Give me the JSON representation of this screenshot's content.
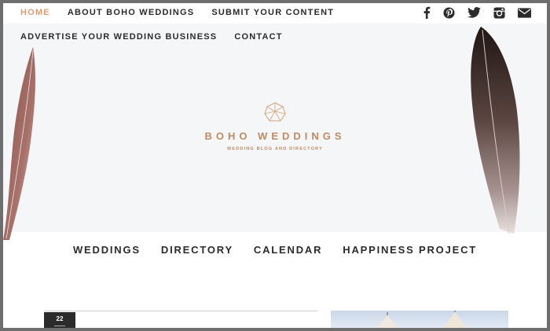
{
  "top_nav": {
    "items": [
      {
        "label": "HOME",
        "active": true
      },
      {
        "label": "ABOUT BOHO WEDDINGS"
      },
      {
        "label": "SUBMIT YOUR CONTENT"
      }
    ],
    "items_row2": [
      {
        "label": "ADVERTISE YOUR WEDDING BUSINESS"
      },
      {
        "label": "CONTACT"
      }
    ]
  },
  "social_icons": [
    "facebook-icon",
    "pinterest-icon",
    "twitter-icon",
    "instagram-icon",
    "email-icon"
  ],
  "brand": {
    "name": "BOHO WEDDINGS",
    "tagline": "WEDDING BLOG AND DIRECTORY",
    "accent_color": "#c08a64"
  },
  "main_nav": [
    "WEDDINGS",
    "DIRECTORY",
    "CALENDAR",
    "HAPPINESS PROJECT"
  ],
  "post": {
    "date_day": "22"
  },
  "colors": {
    "active_nav": "#d8a07a",
    "text_dark": "#2b2b2b",
    "hero_bg": "#f5f6f8"
  }
}
